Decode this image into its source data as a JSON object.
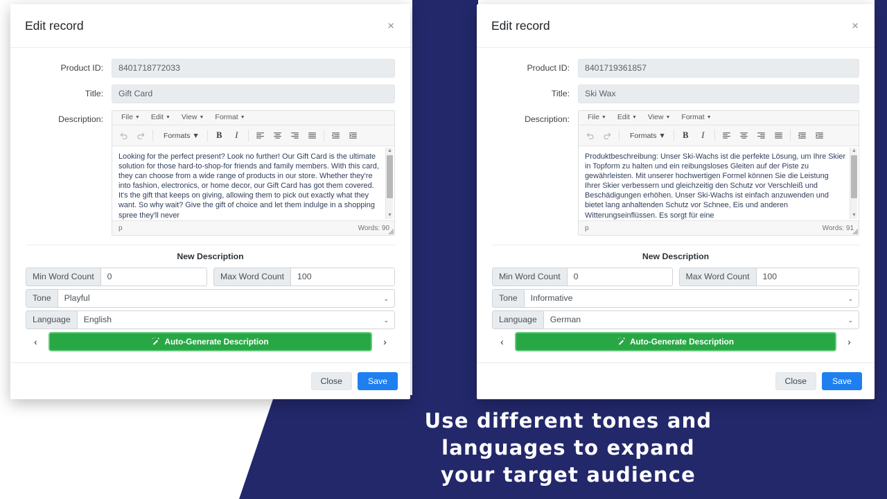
{
  "theme": {
    "navy": "#23286b",
    "green": "#28a745",
    "blue": "#1d7ff0"
  },
  "caption": {
    "line1": "Use different tones and",
    "line2": "languages to expand",
    "line3": "your target audience"
  },
  "editor_toolbar": {
    "menus": [
      "File",
      "Edit",
      "View",
      "Format"
    ],
    "undo_icon": "undo-icon",
    "redo_icon": "redo-icon",
    "formats_label": "Formats",
    "bold_label": "B",
    "italic_label": "I",
    "align_left_icon": "align-left-icon",
    "align_center_icon": "align-center-icon",
    "align_right_icon": "align-right-icon",
    "align_justify_icon": "align-justify-icon",
    "outdent_icon": "outdent-icon",
    "indent_icon": "indent-icon"
  },
  "labels": {
    "product_id": "Product ID:",
    "title": "Title:",
    "description": "Description:",
    "new_description": "New Description",
    "min_word_count": "Min Word Count",
    "max_word_count": "Max Word Count",
    "tone": "Tone",
    "language": "Language",
    "generate": "Auto-Generate Description",
    "close": "Close",
    "save": "Save",
    "status_element": "p",
    "prev_arrow": "‹",
    "next_arrow": "›",
    "close_x": "×"
  },
  "dialogs": [
    {
      "id": "left",
      "title": "Edit record",
      "product_id": "8401718772033",
      "product_title": "Gift Card",
      "description": "Looking for the perfect present? Look no further! Our Gift Card is the ultimate solution for those hard-to-shop-for friends and family members. With this card, they can choose from a wide range of products in our store. Whether they're into fashion, electronics, or home decor, our Gift Card has got them covered. It's the gift that keeps on giving, allowing them to pick out exactly what they want. So why wait? Give the gift of choice and let them indulge in a shopping spree they'll never",
      "word_count": "Words: 90",
      "min_word_count": "0",
      "max_word_count": "100",
      "tone": "Playful",
      "language": "English"
    },
    {
      "id": "right",
      "title": "Edit record",
      "product_id": "8401719361857",
      "product_title": "Ski Wax",
      "description": "Produktbeschreibung: Unser Ski-Wachs ist die perfekte Lösung, um Ihre Skier in Topform zu halten und ein reibungsloses Gleiten auf der Piste zu gewährleisten. Mit unserer hochwertigen Formel können Sie die Leistung Ihrer Skier verbessern und gleichzeitig den Schutz vor Verschleiß und Beschädigungen erhöhen. Unser Ski-Wachs ist einfach anzuwenden und bietet lang anhaltenden Schutz vor Schnee, Eis und anderen Witterungseinflüssen. Es sorgt für eine",
      "word_count": "Words: 91",
      "min_word_count": "0",
      "max_word_count": "100",
      "tone": "Informative",
      "language": "German"
    }
  ]
}
